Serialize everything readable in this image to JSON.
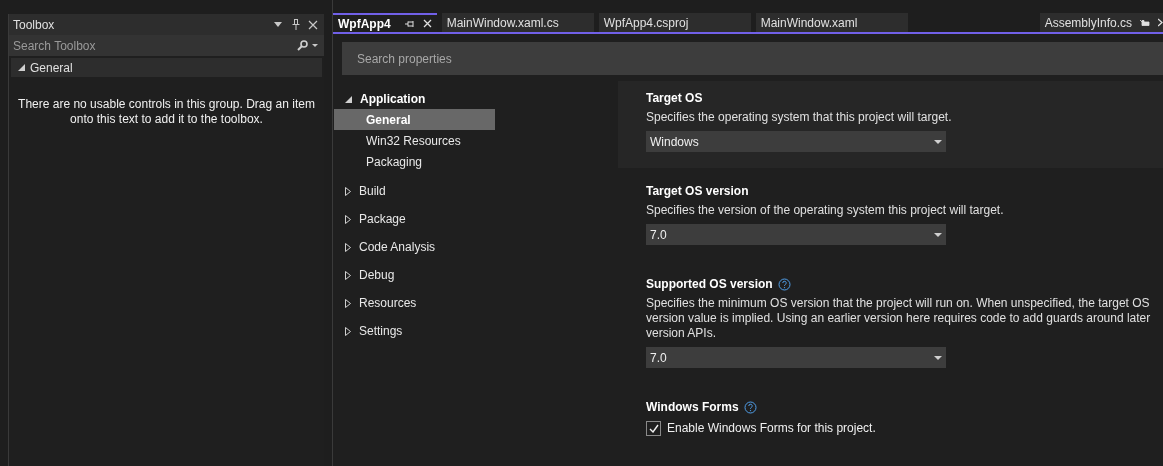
{
  "toolbox": {
    "title": "Toolbox",
    "search": {
      "placeholder": "Search Toolbox"
    },
    "group": {
      "label": "General",
      "expanded": true
    },
    "empty_message": "There are no usable controls in this group. Drag an item onto this text to add it to the toolbox."
  },
  "tabs": [
    {
      "label": "WpfApp4",
      "selected": true
    },
    {
      "label": "MainWindow.xaml.cs",
      "selected": false
    },
    {
      "label": "WpfApp4.csproj",
      "selected": false
    },
    {
      "label": "MainWindow.xaml",
      "selected": false
    }
  ],
  "pinned_tabs": [
    {
      "label": "AssemblyInfo.cs",
      "selected": false
    }
  ],
  "search": {
    "placeholder": "Search properties"
  },
  "nav": [
    {
      "label": "Application",
      "expanded": true,
      "children": [
        {
          "label": "General",
          "selected": true
        },
        {
          "label": "Win32 Resources",
          "selected": false
        },
        {
          "label": "Packaging",
          "selected": false
        }
      ]
    },
    {
      "label": "Build",
      "expanded": false
    },
    {
      "label": "Package",
      "expanded": false
    },
    {
      "label": "Code Analysis",
      "expanded": false
    },
    {
      "label": "Debug",
      "expanded": false
    },
    {
      "label": "Resources",
      "expanded": false
    },
    {
      "label": "Settings",
      "expanded": false
    }
  ],
  "sections": [
    {
      "kind": "dropdown",
      "title": "Target OS",
      "help": false,
      "highlighted": true,
      "description": "Specifies the operating system that this project will target.",
      "value": "Windows"
    },
    {
      "kind": "dropdown",
      "title": "Target OS version",
      "help": false,
      "highlighted": false,
      "description": "Specifies the version of the operating system this project will target.",
      "value": "7.0"
    },
    {
      "kind": "dropdown",
      "title": "Supported OS version",
      "help": true,
      "highlighted": false,
      "description": "Specifies the minimum OS version that the project will run on. When unspecified, the target OS version value is implied. Using an earlier version here requires code to add guards around later version APIs.",
      "value": "7.0"
    },
    {
      "kind": "checkbox",
      "title": "Windows Forms",
      "help": true,
      "highlighted": false,
      "label": "Enable Windows Forms for this project.",
      "checked": true
    }
  ]
}
